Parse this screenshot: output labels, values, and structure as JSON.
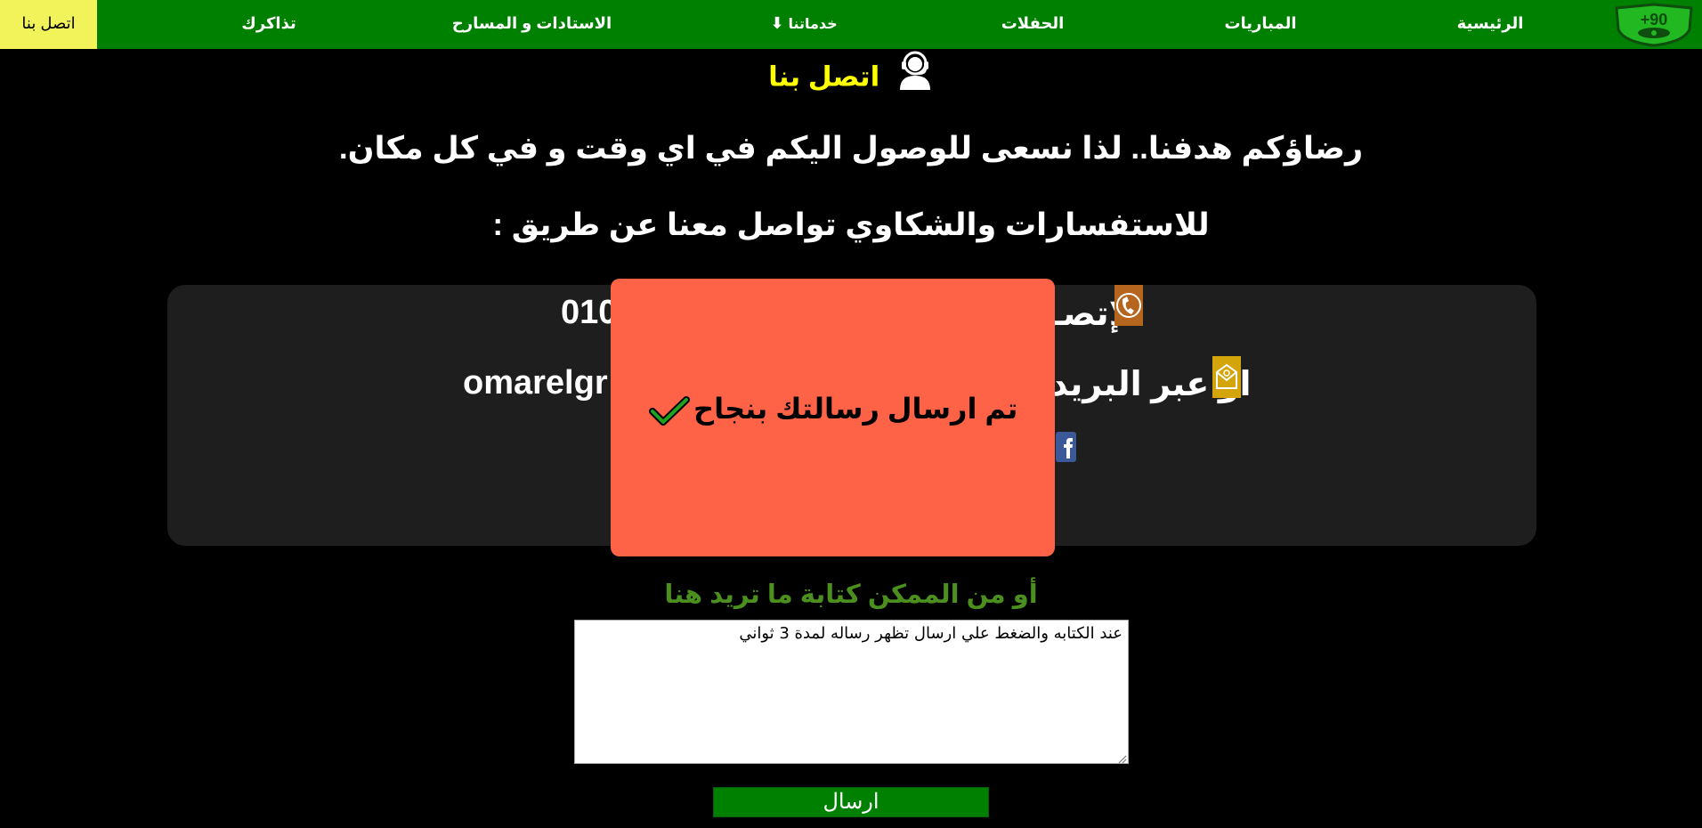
{
  "nav": {
    "logo_text": "+90",
    "items": [
      {
        "label": "الرئيسية"
      },
      {
        "label": "المباريات"
      },
      {
        "label": "الحفلات"
      },
      {
        "label": "خدماتنا",
        "icon": "arrow-down-icon"
      },
      {
        "label": "الاستادات و المسارح"
      },
      {
        "label": "تذاكرك"
      },
      {
        "label": "اتصل بنا",
        "active": true
      }
    ],
    "colors": {
      "bar": "#008000",
      "active_bg": "#f2f25a"
    }
  },
  "contact": {
    "title": "اتصل بنا",
    "title_icon": "support-headset-icon",
    "line1": "رضاؤكم هدفنا.. لذا نسعى للوصول اليكم في اي وقت و في كل مكان.",
    "line2": "للاستفسارات والشكاوي تواصل معنا عن طريق :",
    "phone_text": "لإتصـ",
    "phone_number": "010",
    "phone_icon": "phone-icon",
    "email_text": "او عبر البريد",
    "email_value": "omarelgr",
    "email_icon": "email-icon",
    "facebook_icon": "facebook-icon"
  },
  "popup": {
    "message": "تم ارسال رسالتك بنجاح",
    "icon": "checkmark-icon",
    "color": "#ff6347"
  },
  "form": {
    "label": "أو من الممكن كتابة ما تريد هنا",
    "message_value": "عند الكتابه والضغط علي ارسال تظهر رساله لمدة 3 ثواني",
    "submit_label": "ارسال"
  }
}
